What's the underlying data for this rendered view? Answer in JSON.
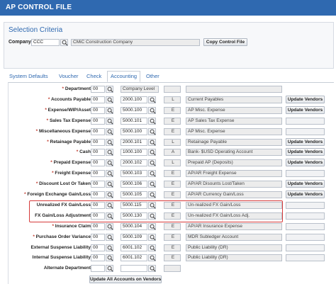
{
  "window": {
    "title": "AP CONTROL FILE"
  },
  "criteria": {
    "title": "Selection Criteria",
    "company_label": "Company",
    "company_code": "CCC",
    "company_name": "CMiC Construction Company",
    "copy_button": "Copy Control File"
  },
  "tabs": [
    {
      "label": "System Defaults",
      "active": false
    },
    {
      "label": "Voucher",
      "active": false
    },
    {
      "label": "Check",
      "active": false
    },
    {
      "label": "Accounting",
      "active": true
    },
    {
      "label": "Other",
      "active": false
    }
  ],
  "rows": [
    {
      "label": "Department",
      "required": true,
      "dept": "00",
      "account": "Company Level",
      "type": "",
      "desc": "",
      "button": ""
    },
    {
      "label": "Accounts Payable",
      "required": true,
      "dept": "00",
      "account": "2000.100",
      "type": "L",
      "desc": "Current Payables",
      "button": "Update Vendors"
    },
    {
      "label": "Expense/WIP/Asset",
      "required": true,
      "dept": "00",
      "account": "5000.100",
      "type": "E",
      "desc": "AP Misc. Expense",
      "button": "Update Vendors"
    },
    {
      "label": "Sales Tax Expense",
      "required": true,
      "dept": "00",
      "account": "5000.101",
      "type": "E",
      "desc": "AP Sales Tax Expense",
      "button": ""
    },
    {
      "label": "Miscellaneous Expense",
      "required": true,
      "dept": "00",
      "account": "5000.100",
      "type": "E",
      "desc": "AP Misc. Expense",
      "button": ""
    },
    {
      "label": "Retainage Payable",
      "required": true,
      "dept": "00",
      "account": "2000.101",
      "type": "L",
      "desc": "Retainage Payable",
      "button": "Update Vendors"
    },
    {
      "label": "Cash",
      "required": true,
      "dept": "00",
      "account": "1000.100",
      "type": "A",
      "desc": "Bank- $USD Operating Account",
      "button": "Update Vendors"
    },
    {
      "label": "Prepaid Expense",
      "required": true,
      "dept": "00",
      "account": "2000.102",
      "type": "L",
      "desc": "Prepaid AP (Deposits)",
      "button": "Update Vendors"
    },
    {
      "label": "Freight Expense",
      "required": true,
      "dept": "00",
      "account": "5000.103",
      "type": "E",
      "desc": "AP/AR Freight Expense",
      "button": ""
    },
    {
      "label": "Discount Lost Or Taken",
      "required": true,
      "dept": "00",
      "account": "5000.106",
      "type": "E",
      "desc": "AP/AR Disounts Lost/Taken",
      "button": "Update Vendors"
    },
    {
      "label": "Foreign Exchange Gain/Loss",
      "required": true,
      "dept": "00",
      "account": "5000.105",
      "type": "E",
      "desc": "AP/AR Currency Gain/Loss",
      "button": "Update Vendors"
    },
    {
      "label": "Unrealized FX Gain/Loss",
      "required": false,
      "dept": "00",
      "account": "5000.115",
      "type": "E",
      "desc": "Un-realized FX Gain/Loss",
      "button": ""
    },
    {
      "label": "FX Gain/Loss Adjustment",
      "required": false,
      "dept": "00",
      "account": "5000.130",
      "type": "E",
      "desc": "Un-realized FX Gain/Loss Adj.",
      "button": ""
    },
    {
      "label": "Insurance Claim",
      "required": true,
      "dept": "00",
      "account": "5000.104",
      "type": "E",
      "desc": "AP/AR Insurance Expense",
      "button": ""
    },
    {
      "label": "Purchase Order Variance",
      "required": true,
      "dept": "00",
      "account": "5000.109",
      "type": "E",
      "desc": "MDR Subledger Account",
      "button": ""
    },
    {
      "label": "External Suspense Liability",
      "required": false,
      "dept": "00",
      "account": "6001.102",
      "type": "E",
      "desc": "Public Liability (DR)",
      "button": ""
    },
    {
      "label": "Internal Suspense Liability",
      "required": false,
      "dept": "00",
      "account": "6001.102",
      "type": "E",
      "desc": "Public Liability (DR)",
      "button": ""
    },
    {
      "label": "Alternate Department",
      "required": false,
      "dept": "",
      "account": "",
      "type": "",
      "desc": "",
      "button": ""
    }
  ],
  "footer": {
    "update_all_button": "Update All Accounts on Vendors"
  }
}
